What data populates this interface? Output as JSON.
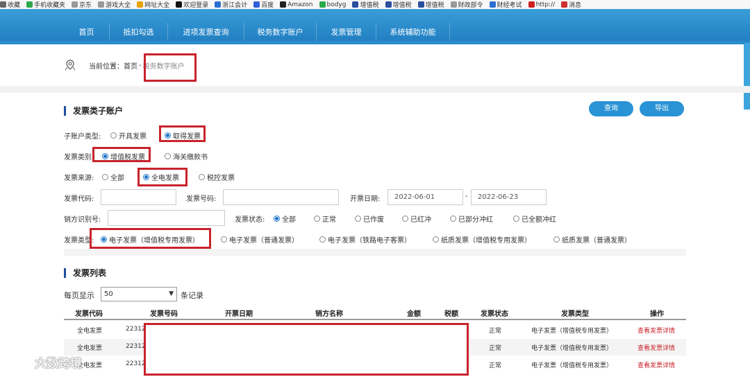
{
  "bookmarks": [
    {
      "label": "收藏",
      "icon": "bookmark-icon",
      "color": "#666666"
    },
    {
      "label": "手机收藏夹",
      "icon": "phone-icon",
      "color": "#2aa84a"
    },
    {
      "label": "京东",
      "icon": "globe-icon",
      "color": "#999999"
    },
    {
      "label": "游戏大全",
      "icon": "globe-icon",
      "color": "#999999"
    },
    {
      "label": "网址大全",
      "icon": "site-icon",
      "color": "#e8a20c"
    },
    {
      "label": "欢迎登录",
      "icon": "ai-icon",
      "color": "#111111"
    },
    {
      "label": "浙江会计",
      "icon": "doc-icon",
      "color": "#2a6fcf"
    },
    {
      "label": "百度",
      "icon": "baidu-icon",
      "color": "#3060d8"
    },
    {
      "label": "Amazon",
      "icon": "amazon-icon",
      "color": "#222222"
    },
    {
      "label": "bodyg",
      "icon": "plus-icon",
      "color": "#2aa84a"
    },
    {
      "label": "增值税",
      "icon": "tax-icon",
      "color": "#2a4fa0"
    },
    {
      "label": "增值税",
      "icon": "tax-icon",
      "color": "#2a4fa0"
    },
    {
      "label": "增值税",
      "icon": "tax-icon",
      "color": "#2a4fa0"
    },
    {
      "label": "财政部令",
      "icon": "globe-icon",
      "color": "#999999"
    },
    {
      "label": "财经考试",
      "icon": "s-icon",
      "color": "#2a6fcf"
    },
    {
      "label": "http://",
      "icon": "red-icon",
      "color": "#d02020"
    },
    {
      "label": "消息",
      "icon": "weibo-icon",
      "color": "#d03030"
    }
  ],
  "nav": [
    "首页",
    "抵扣勾选",
    "进项发票查询",
    "税务数字账户",
    "发票管理",
    "系统辅助功能"
  ],
  "breadcrumb": {
    "prefix": "当前位置：",
    "home": "首页",
    "sep": "-",
    "current": "税务数字账户"
  },
  "filter": {
    "title": "发票类子账户",
    "query_btn": "查询",
    "export_btn": "导出",
    "account_type": {
      "label": "子账户类型:",
      "options": [
        "开具发票",
        "取得发票"
      ],
      "selected": 1
    },
    "invoice_category": {
      "label": "发票类别:",
      "options": [
        "增值税发票",
        "海关缴款书"
      ],
      "selected": 0
    },
    "invoice_source": {
      "label": "发票来源:",
      "options": [
        "全部",
        "全电发票",
        "税控发票"
      ],
      "selected": 1
    },
    "code_label": "发票代码:",
    "number_label": "发票号码:",
    "date_label": "开票日期:",
    "date_from": "2022-06-01",
    "date_sep": "-",
    "date_to": "2022-06-23",
    "seller_id_label": "销方识别号:",
    "status": {
      "label": "发票状态:",
      "options": [
        "全部",
        "正常",
        "已作废",
        "已红冲",
        "已部分冲红",
        "已全额冲红"
      ],
      "selected": 0
    },
    "invoice_type": {
      "label": "发票类型:",
      "options": [
        "电子发票（增值税专用发票）",
        "电子发票（普通发票）",
        "电子发票（铁路电子客票）",
        "纸质发票（增值税专用发票）",
        "纸质发票（普通发票）"
      ],
      "selected": 0
    }
  },
  "list": {
    "title": "发票列表",
    "page_size_label": "每页显示",
    "page_size": "50",
    "page_size_suffix": "条记录",
    "headers": [
      "发票代码",
      "发票号码",
      "开票日期",
      "销方名称",
      "金额",
      "税额",
      "发票状态",
      "发票类型",
      "操作"
    ],
    "rows": [
      {
        "code": "全电发票",
        "number": "22312",
        "status": "正常",
        "type": "电子发票（增值税专用发票）",
        "action": "查看发票详情"
      },
      {
        "code": "全电发票",
        "number": "22312",
        "status": "正常",
        "type": "电子发票（增值税专用发票）",
        "action": "查看发票详情"
      },
      {
        "code": "全电发票",
        "number": "22312",
        "status": "正常",
        "type": "电子发票（增值税专用发票）",
        "action": "查看发票详情"
      }
    ]
  },
  "watermark": "大数跨境",
  "colors": {
    "nav": "#1f7cc0",
    "accent": "#2a93d5",
    "highlight": "#c8232b",
    "title_bar": "#1d4fa0"
  }
}
